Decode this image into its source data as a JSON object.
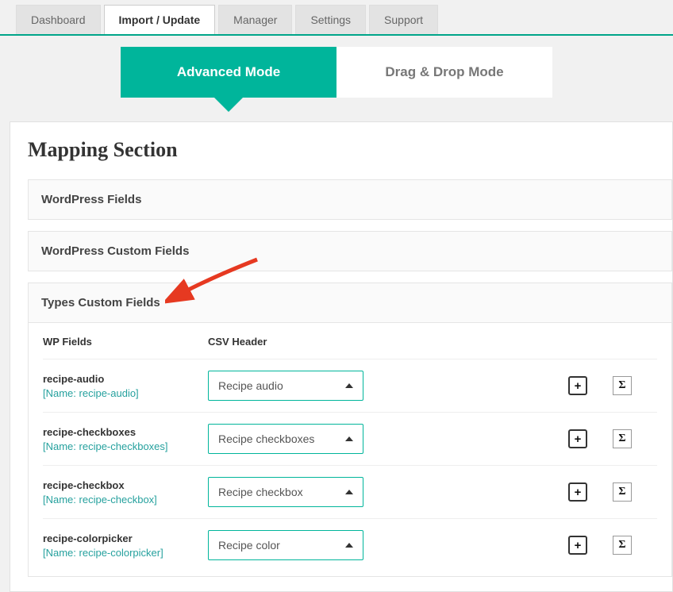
{
  "tabs": [
    {
      "label": "Dashboard",
      "active": false
    },
    {
      "label": "Import / Update",
      "active": true
    },
    {
      "label": "Manager",
      "active": false
    },
    {
      "label": "Settings",
      "active": false
    },
    {
      "label": "Support",
      "active": false
    }
  ],
  "modes": {
    "advanced": "Advanced Mode",
    "dragdrop": "Drag & Drop Mode"
  },
  "panel": {
    "title": "Mapping Section",
    "sections": [
      {
        "title": "WordPress Fields",
        "open": false
      },
      {
        "title": "WordPress Custom Fields",
        "open": false
      },
      {
        "title": "Types Custom Fields",
        "open": true
      }
    ],
    "columns": {
      "wp": "WP Fields",
      "csv": "CSV Header"
    },
    "rows": [
      {
        "name": "recipe-audio",
        "meta": "[Name: recipe-audio]",
        "csv": "Recipe audio"
      },
      {
        "name": "recipe-checkboxes",
        "meta": "[Name: recipe-checkboxes]",
        "csv": "Recipe checkboxes"
      },
      {
        "name": "recipe-checkbox",
        "meta": "[Name: recipe-checkbox]",
        "csv": "Recipe checkbox"
      },
      {
        "name": "recipe-colorpicker",
        "meta": "[Name: recipe-colorpicker]",
        "csv": "Recipe color"
      }
    ]
  },
  "icons": {
    "plus": "+",
    "sigma": "Σ"
  }
}
